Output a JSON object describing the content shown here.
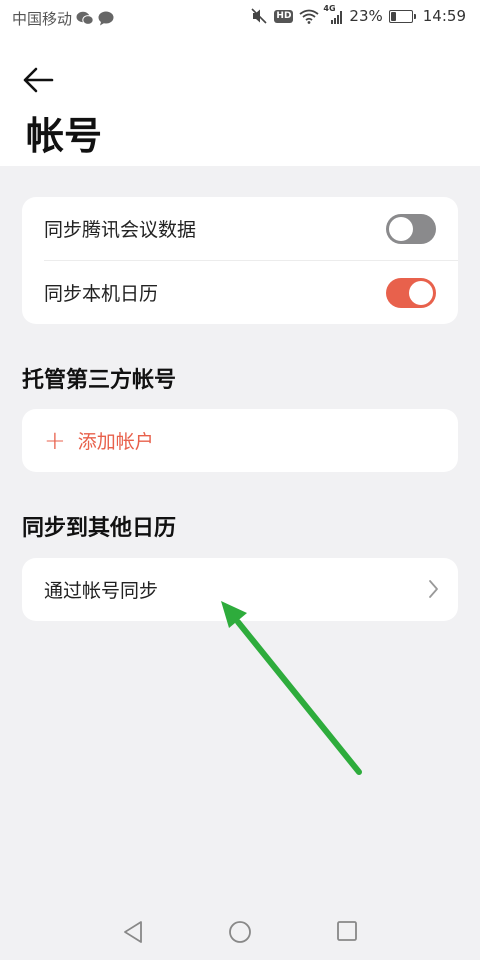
{
  "status_bar": {
    "carrier": "中国移动",
    "battery_text": "23%",
    "battery_level": 0.23,
    "network_label": "4G",
    "hd_label": "HD",
    "time": "14:59"
  },
  "header": {
    "back_icon": "back-arrow-icon",
    "title": "帐号"
  },
  "sync_card": {
    "items": [
      {
        "label": "同步腾讯会议数据",
        "toggle_on": false
      },
      {
        "label": "同步本机日历",
        "toggle_on": true
      }
    ]
  },
  "third_party": {
    "section_title": "托管第三方帐号",
    "add_plus": "+",
    "add_label": "添加帐户"
  },
  "other_calendars": {
    "section_title": "同步到其他日历",
    "item_label": "通过帐号同步"
  },
  "colors": {
    "accent": "#e8614c",
    "toggle_off": "#8a8a8c",
    "annotation_arrow": "#2eac3c",
    "background": "#f1f1f3"
  }
}
